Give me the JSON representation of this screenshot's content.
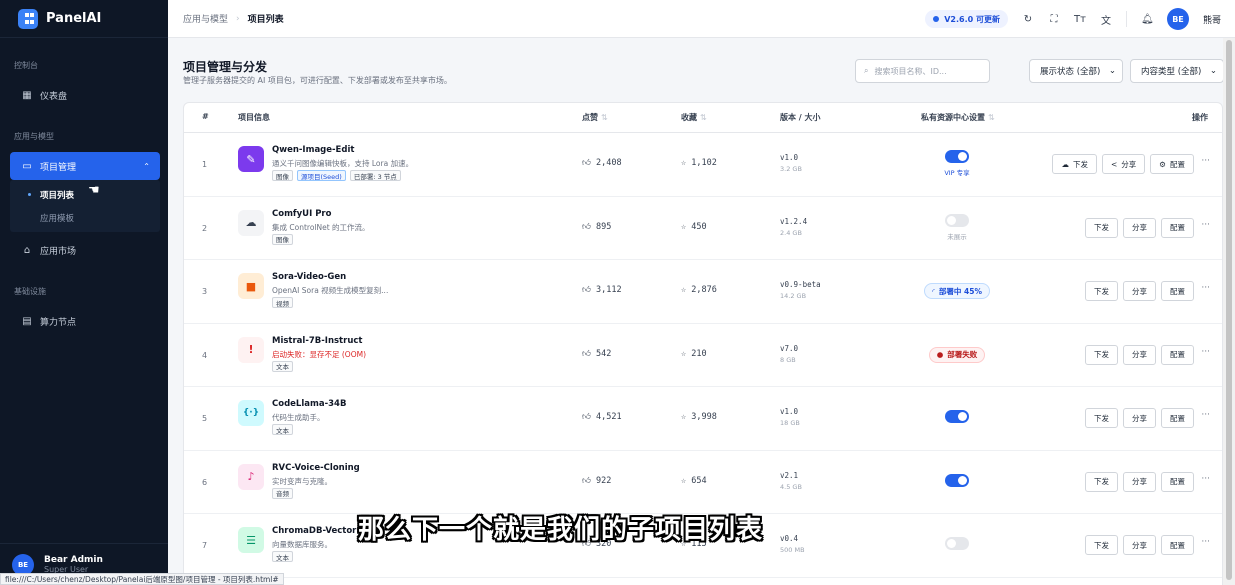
{
  "sidebar": {
    "brand": "PanelAI",
    "sections": [
      {
        "label": "控制台"
      },
      {
        "label": "应用与模型"
      },
      {
        "label": "基础设施"
      }
    ],
    "dashboard": "仪表盘",
    "project_mgmt": "项目管理",
    "sub_items": [
      "项目列表",
      "应用模板"
    ],
    "app_market": "应用市场",
    "compute_nodes": "算力节点",
    "user": {
      "initials": "BE",
      "name": "Bear Admin",
      "role": "Super User"
    }
  },
  "topbar": {
    "breadcrumb": [
      "应用与模型",
      "项目列表"
    ],
    "version_badge": "V2.6.0 可更新",
    "user_initials": "BE",
    "user_name": "熊哥"
  },
  "page": {
    "title": "项目管理与分发",
    "subtitle": "管理子服务器提交的 AI 项目包，可进行配置、下发部署或发布至共享市场。",
    "search_placeholder": "搜索项目名称、ID...",
    "filter_status": "展示状态 (全部)",
    "filter_type": "内容类型 (全部)"
  },
  "table": {
    "headers": {
      "idx": "#",
      "info": "项目信息",
      "likes": "点赞",
      "favs": "收藏",
      "version": "版本 / 大小",
      "private": "私有资源中心设置",
      "ops": "操作"
    },
    "rows": [
      {
        "idx": "1",
        "name": "Qwen-Image-Edit",
        "desc": "通义千问图像编辑快板，支持 Lora 加速。",
        "tags": [
          "图像",
          "源项目(Seed)",
          "已部署: 3 节点"
        ],
        "likes": "2,408",
        "favs": "1,102",
        "version": "v1.0",
        "size": "3.2 GB",
        "priv_label": "VIP 专享",
        "actions": [
          "下发",
          "分享",
          "配置"
        ]
      },
      {
        "idx": "2",
        "name": "ComfyUI Pro",
        "desc": "集成 ControlNet 的工作流。",
        "tags": [
          "图像"
        ],
        "likes": "895",
        "favs": "450",
        "version": "v1.2.4",
        "size": "2.4 GB",
        "priv_label": "未展示",
        "actions": [
          "下发",
          "分享",
          "配置"
        ]
      },
      {
        "idx": "3",
        "name": "Sora-Video-Gen",
        "desc": "OpenAI Sora 视频生成模型复刻...",
        "tags": [
          "视频"
        ],
        "likes": "3,112",
        "favs": "2,876",
        "version": "v0.9-beta",
        "size": "14.2 GB",
        "priv_label": "部署中 45%",
        "actions": [
          "下发",
          "分享",
          "配置"
        ]
      },
      {
        "idx": "4",
        "name": "Mistral-7B-Instruct",
        "desc": "启动失败：显存不足 (OOM)",
        "tags": [
          "文本"
        ],
        "likes": "542",
        "favs": "210",
        "version": "v7.0",
        "size": "8 GB",
        "priv_label": "部署失败",
        "actions": [
          "下发",
          "分享",
          "配置"
        ]
      },
      {
        "idx": "5",
        "name": "CodeLlama-34B",
        "desc": "代码生成助手。",
        "tags": [
          "文本"
        ],
        "likes": "4,521",
        "favs": "3,998",
        "version": "v1.0",
        "size": "18 GB",
        "priv_label": "",
        "actions": [
          "下发",
          "分享",
          "配置"
        ]
      },
      {
        "idx": "6",
        "name": "RVC-Voice-Cloning",
        "desc": "实时变声与克隆。",
        "tags": [
          "音频"
        ],
        "likes": "922",
        "favs": "654",
        "version": "v2.1",
        "size": "4.5 GB",
        "priv_label": "",
        "actions": [
          "下发",
          "分享",
          "配置"
        ]
      },
      {
        "idx": "7",
        "name": "ChromaDB-Vector",
        "desc": "向量数据库服务。",
        "tags": [
          "文本"
        ],
        "likes": "320",
        "favs": "115",
        "version": "v0.4",
        "size": "500 MB",
        "priv_label": "",
        "actions": [
          "下发",
          "分享",
          "配置"
        ]
      }
    ]
  },
  "overlay": {
    "subtitle": "那么下一个就是我们的子项目列表",
    "status_url": "file:///C:/Users/chenz/Desktop/Panelai后端原型图/项目管理 - 项目列表.html#"
  },
  "colors": {
    "accent": "#2563eb",
    "sidebar_bg": "#0e1726",
    "error": "#dc2626"
  }
}
